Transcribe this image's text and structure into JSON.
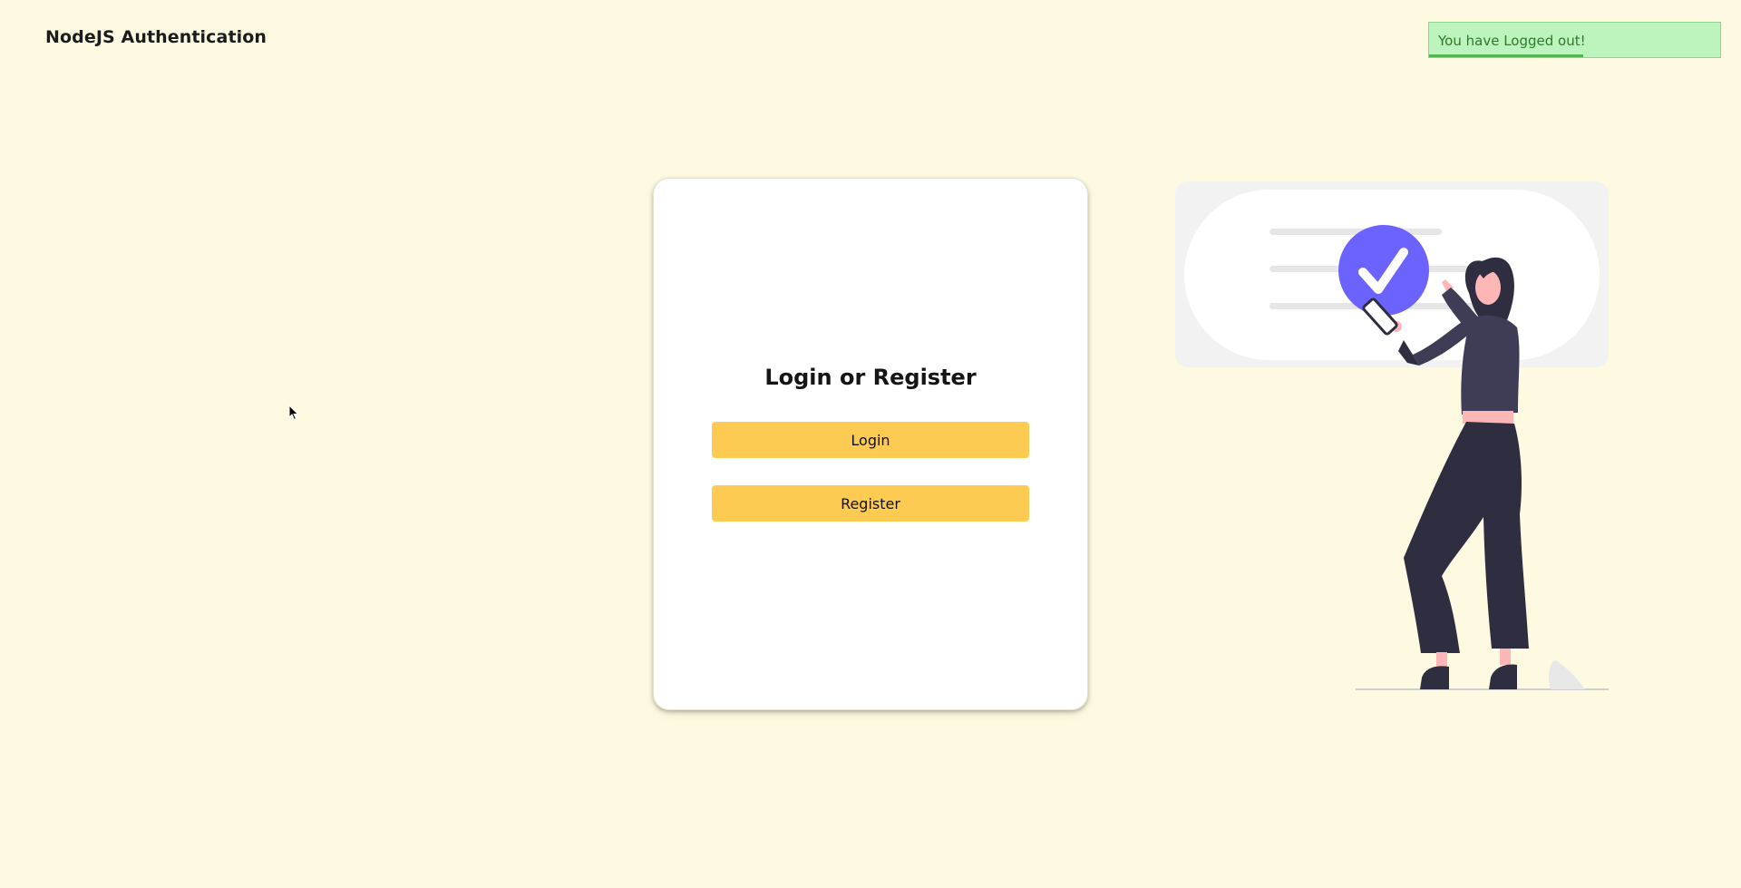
{
  "app": {
    "brand": "NodeJS Authentication"
  },
  "toast": {
    "message": "You have Logged out!",
    "progress": 0.53,
    "colors": {
      "background": "#bdf3bc",
      "border": "#8fd38e",
      "text": "#2c7a2c",
      "progress": "#53b553"
    }
  },
  "card": {
    "title": "Login or Register",
    "login_label": "Login",
    "register_label": "Register"
  },
  "colors": {
    "page_background": "#fef9e1",
    "button": "#fdca52",
    "accent_circle": "#6c63ff"
  },
  "illustration": {
    "icon": "check-circle-icon"
  }
}
